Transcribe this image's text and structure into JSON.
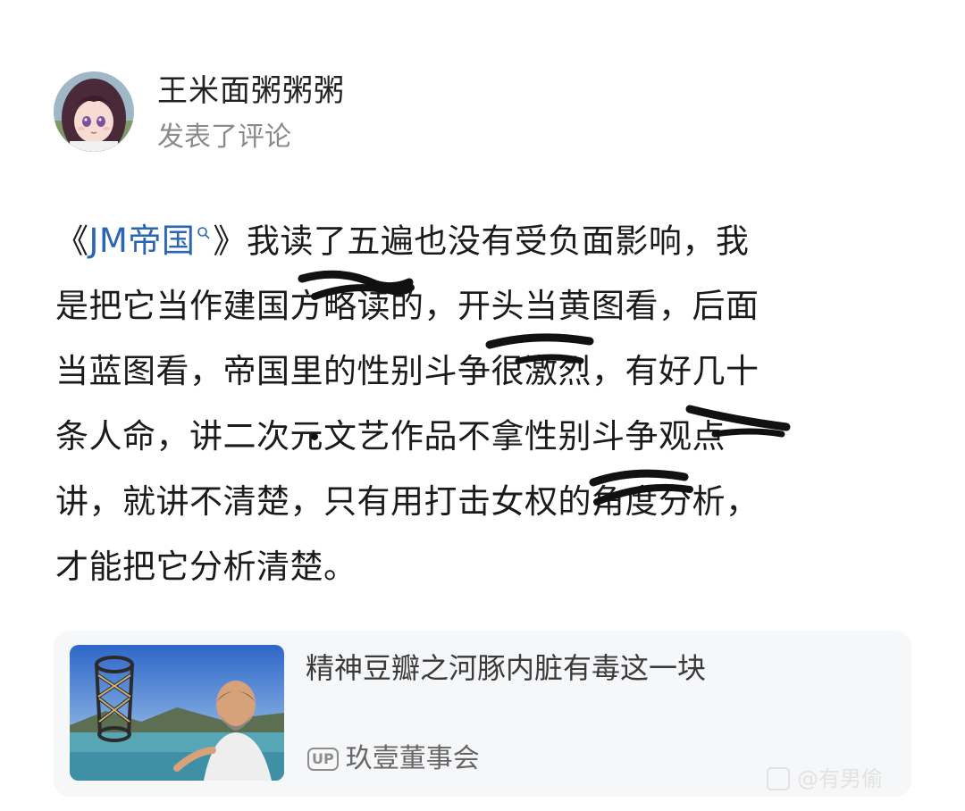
{
  "author": {
    "name": "王米面粥粥粥",
    "action": "发表了评论"
  },
  "comment": {
    "line1_prefix": "《",
    "line1_link": "JM帝国",
    "line1_suffix": "》我读了五遍也没有受负面影响，我",
    "line2": "是把它当作建国方略读的，开头当黄图看，后面",
    "line3": "当蓝图看，帝国里的性别斗争很激烈，有好几十",
    "line4": "条人命，讲二次元文艺作品不拿性别斗争观点",
    "line5": "讲，就讲不清楚，只有用打击女权的角度分析，",
    "line6": "才能把它分析清楚。",
    "link_color": "#2a66b3"
  },
  "video": {
    "title": "精神豆瓣之河豚内脏有毒这一块",
    "up_badge": "UP",
    "uploader": "玖壹董事会"
  },
  "watermark": {
    "text": "@有男偷"
  }
}
